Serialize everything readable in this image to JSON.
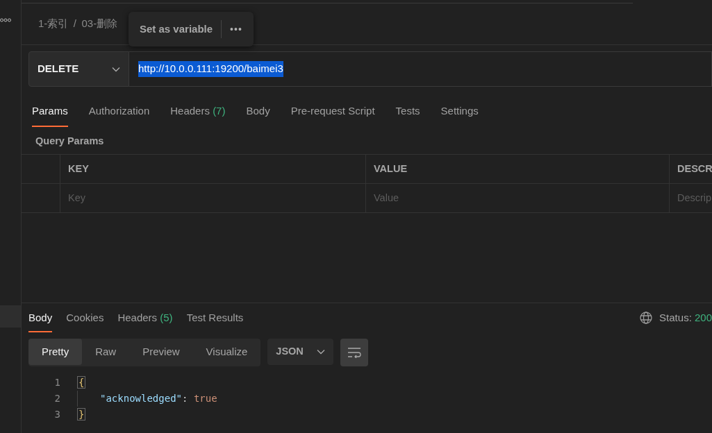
{
  "breadcrumb": {
    "items": [
      "1-索引",
      "03-删除"
    ],
    "separator": "/"
  },
  "popup": {
    "label": "Set as variable",
    "more": "•••"
  },
  "request": {
    "method": "DELETE",
    "url": "http://10.0.0.111:19200/baimei3",
    "url_selected": true
  },
  "request_tabs": [
    {
      "label": "Params",
      "selected": true
    },
    {
      "label": "Authorization",
      "selected": false
    },
    {
      "label": "Headers",
      "count": "(7)",
      "selected": false
    },
    {
      "label": "Body",
      "selected": false
    },
    {
      "label": "Pre-request Script",
      "selected": false
    },
    {
      "label": "Tests",
      "selected": false
    },
    {
      "label": "Settings",
      "selected": false
    }
  ],
  "query_params": {
    "title": "Query Params",
    "columns": [
      "KEY",
      "VALUE",
      "DESCR"
    ],
    "placeholders": [
      "Key",
      "Value",
      "Descrip"
    ]
  },
  "response_tabs": [
    {
      "label": "Body",
      "selected": true
    },
    {
      "label": "Cookies",
      "selected": false
    },
    {
      "label": "Headers",
      "count": "(5)",
      "selected": false
    },
    {
      "label": "Test Results",
      "selected": false
    }
  ],
  "status": {
    "label": "Status:",
    "value": "200"
  },
  "view_modes": [
    {
      "label": "Pretty",
      "selected": true
    },
    {
      "label": "Raw",
      "selected": false
    },
    {
      "label": "Preview",
      "selected": false
    },
    {
      "label": "Visualize",
      "selected": false
    }
  ],
  "format": "JSON",
  "wrap_on": true,
  "code_lines": [
    {
      "number": "1",
      "tokens": [
        {
          "kind": "brace",
          "text": "{"
        }
      ]
    },
    {
      "number": "2",
      "tokens": [
        {
          "kind": "key",
          "text": "\"acknowledged\""
        },
        {
          "kind": "punct",
          "text": ": "
        },
        {
          "kind": "boolean",
          "text": "true"
        }
      ]
    },
    {
      "number": "3",
      "tokens": [
        {
          "kind": "brace",
          "text": "}"
        }
      ]
    }
  ]
}
